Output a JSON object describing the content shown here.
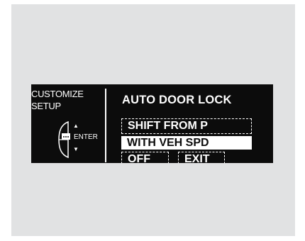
{
  "display": {
    "side_title": "CUSTOMIZE\nSETUP",
    "enter_label": "ENTER",
    "arrow_up": "▲",
    "arrow_down": "▼",
    "menu_title": "AUTO DOOR LOCK",
    "options": [
      {
        "label": "SHIFT FROM P",
        "selected": false
      },
      {
        "label": "WITH VEH SPD",
        "selected": true
      },
      {
        "label": "OFF",
        "selected": false
      },
      {
        "label": "EXIT",
        "selected": false
      }
    ]
  },
  "colors": {
    "panel_background": "#e1e2e3",
    "display_background": "#0c0c0c",
    "display_text": "#ffffff"
  }
}
